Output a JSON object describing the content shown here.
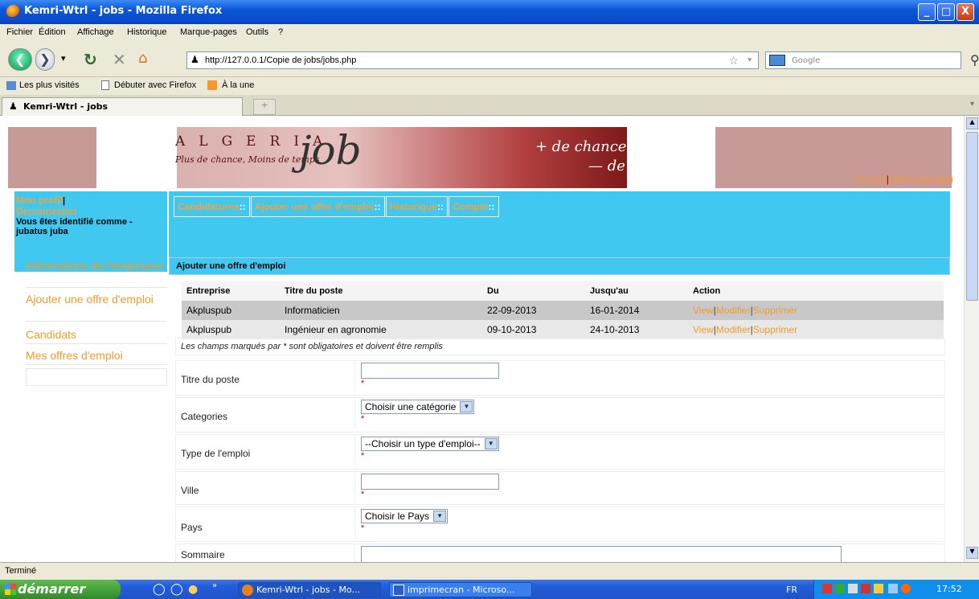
{
  "window": {
    "title": "Kemri-Wtrl - jobs - Mozilla Firefox",
    "minimize": "_",
    "maximize": "□",
    "close": "X"
  },
  "menu": [
    "Fichier",
    "Édition",
    "Affichage",
    "Historique",
    "Marque-pages",
    "Outils",
    "?"
  ],
  "nav": {
    "url": "http://127.0.0.1/Copie de jobs/jobs.php",
    "search_placeholder": "Google"
  },
  "bookmarks": [
    "Les plus visités",
    "Débuter avec Firefox",
    "À la une"
  ],
  "tab": {
    "label": "Kemri-Wtrl - jobs",
    "new": "+"
  },
  "banner": {
    "logo_letters": "ALGERIA",
    "logo_tagline": "Plus de chance, Moins de temps",
    "logo_word": "job",
    "slogan_1": "+ de chance",
    "slogan_2": "— de temps",
    "link_home": "Accueil",
    "link_offers": "Offres d'emploi",
    "sep": "|"
  },
  "account": {
    "profile": "Mon profil",
    "sep": "|",
    "logout": "Deconnexion",
    "identified": "Vous êtes identifié comme - jubatus juba"
  },
  "topnav": [
    "Candidatures",
    "Ajouter une offre d'emploi",
    "Historique",
    "Compte"
  ],
  "topnav_sep": "::",
  "leftmenu": [
    "Informations de l'employeur",
    "Ajouter une offre d'emploi",
    "Candidats",
    "Mes offres d'emploi"
  ],
  "main": {
    "header": "Ajouter une offre d'emploi",
    "table_headers": [
      "Entreprise",
      "Titre du poste",
      "Du",
      "Jusqu'au",
      "Action"
    ],
    "rows": [
      {
        "company": "Akpluspub",
        "title": "Informaticien",
        "from": "22-09-2013",
        "to": "16-01-2014"
      },
      {
        "company": "Akpluspub",
        "title": "Ingénieur en agronomie",
        "from": "09-10-2013",
        "to": "24-10-2013"
      }
    ],
    "actions": {
      "view": "View",
      "edit": "Modifier",
      "delete": "Supprimer",
      "sep": "|"
    },
    "required_note": "Les champs marqués par * sont obligatoires et doivent être remplis",
    "form": {
      "title_label": "Titre du poste",
      "category_label": "Categories",
      "category_value": "Choisir une catégorie",
      "jobtype_label": "Type de l'emploi",
      "jobtype_value": "--Choisir un type d'emploi--",
      "city_label": "Ville",
      "country_label": "Pays",
      "country_value": "Choisir le Pays",
      "summary_label": "Sommaire",
      "required_mark": "*"
    }
  },
  "status": "Terminé",
  "taskbar": {
    "start": "démarrer",
    "task1": "Kemri-Wtrl - jobs - Mo...",
    "task2": "imprimecran - Microso...",
    "lang": "FR",
    "clock": "17:52"
  }
}
